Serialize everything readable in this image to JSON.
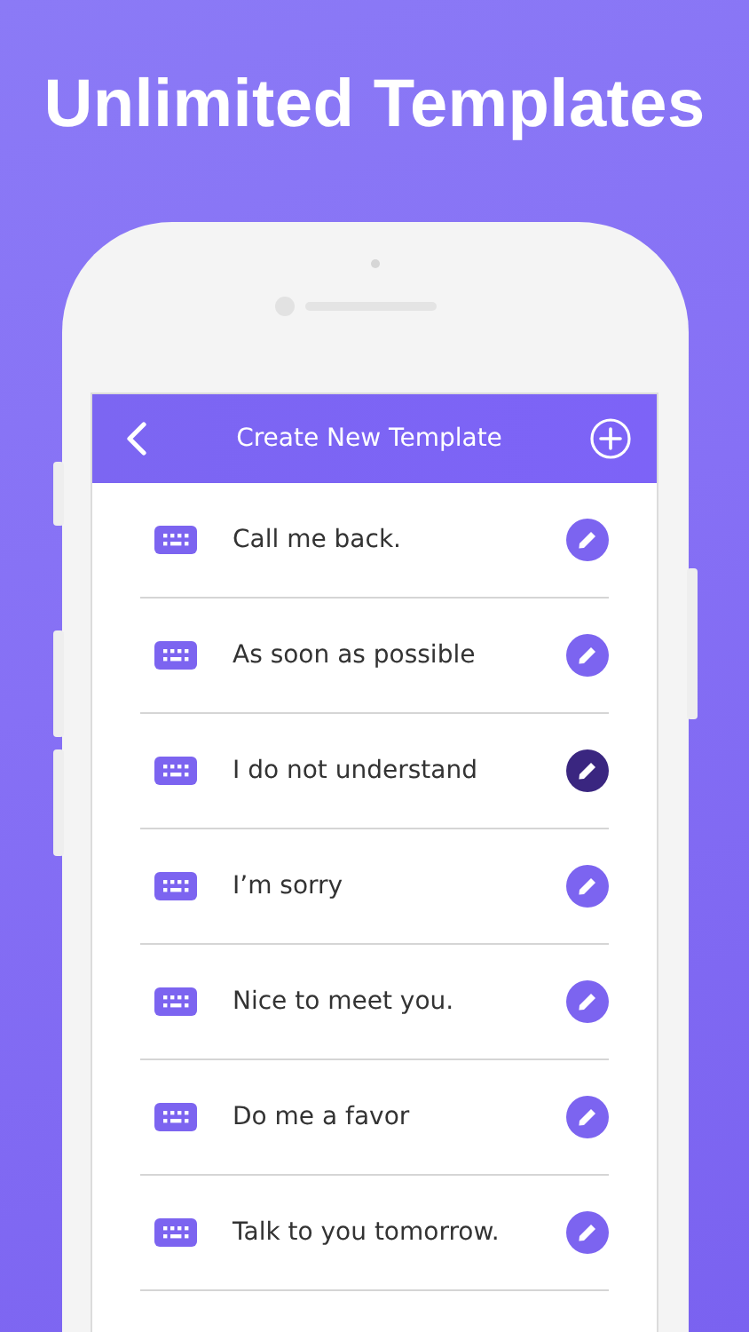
{
  "headline": "Unlimited Templates",
  "app_bar": {
    "title": "Create New Template"
  },
  "templates": [
    {
      "text": "Call me back.",
      "selected": false
    },
    {
      "text": "As soon as possible",
      "selected": false
    },
    {
      "text": "I do not understand",
      "selected": true
    },
    {
      "text": "I’m sorry",
      "selected": false
    },
    {
      "text": "Nice to meet you.",
      "selected": false
    },
    {
      "text": "Do me a favor",
      "selected": false
    },
    {
      "text": "Talk to you tomorrow.",
      "selected": false
    }
  ]
}
